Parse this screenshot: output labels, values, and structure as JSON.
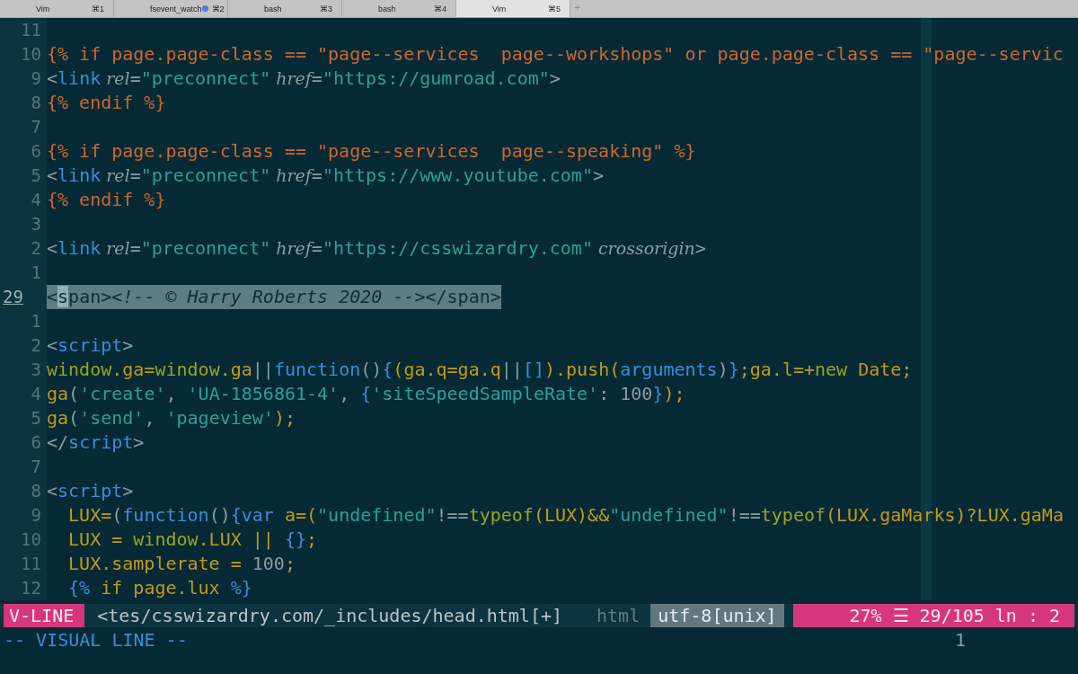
{
  "tabs": [
    {
      "title": "Vim",
      "shortcut": "⌘1",
      "selected": false,
      "activity": false
    },
    {
      "title": "fsevent_watch",
      "shortcut": "⌘2",
      "selected": false,
      "activity": true
    },
    {
      "title": "bash",
      "shortcut": "⌘3",
      "selected": false,
      "activity": false
    },
    {
      "title": "bash",
      "shortcut": "⌘4",
      "selected": false,
      "activity": false
    },
    {
      "title": "Vim",
      "shortcut": "⌘5",
      "selected": true,
      "activity": false
    }
  ],
  "new_tab": "+",
  "editor": {
    "lines": [
      {
        "number": "11",
        "selected": false,
        "current": false
      },
      {
        "number": "10",
        "selected": false,
        "current": false,
        "segments": [
          {
            "text": "{% if page.page-class == \"page--services  page--workshops\" or page.page-class == \"page--servic",
            "kind": "liquid"
          }
        ]
      },
      {
        "number": "9",
        "selected": false,
        "current": false,
        "segments": [
          {
            "text": "<",
            "kind": "punct"
          },
          {
            "text": "link",
            "kind": "tag"
          },
          {
            "text": " rel",
            "kind": "attr"
          },
          {
            "text": "=",
            "kind": "punct"
          },
          {
            "text": "\"preconnect\"",
            "kind": "string"
          },
          {
            "text": " href",
            "kind": "attr"
          },
          {
            "text": "=",
            "kind": "punct"
          },
          {
            "text": "\"https://gumroad.com\"",
            "kind": "string"
          },
          {
            "text": ">",
            "kind": "punct"
          }
        ]
      },
      {
        "number": "8",
        "selected": false,
        "current": false,
        "segments": [
          {
            "text": "{% endif %}",
            "kind": "liquid"
          }
        ]
      },
      {
        "number": "7",
        "selected": false,
        "current": false
      },
      {
        "number": "6",
        "selected": false,
        "current": false,
        "segments": [
          {
            "text": "{% if page.page-class == \"page--services  page--speaking\" %}",
            "kind": "liquid"
          }
        ]
      },
      {
        "number": "5",
        "selected": false,
        "current": false,
        "segments": [
          {
            "text": "<",
            "kind": "punct"
          },
          {
            "text": "link",
            "kind": "tag"
          },
          {
            "text": " rel",
            "kind": "attr"
          },
          {
            "text": "=",
            "kind": "punct"
          },
          {
            "text": "\"preconnect\"",
            "kind": "string"
          },
          {
            "text": " href",
            "kind": "attr"
          },
          {
            "text": "=",
            "kind": "punct"
          },
          {
            "text": "\"https://www.youtube.com\"",
            "kind": "string"
          },
          {
            "text": ">",
            "kind": "punct"
          }
        ]
      },
      {
        "number": "4",
        "selected": false,
        "current": false,
        "segments": [
          {
            "text": "{% endif %}",
            "kind": "liquid"
          }
        ]
      },
      {
        "number": "3",
        "selected": false,
        "current": false
      },
      {
        "number": "2",
        "selected": false,
        "current": false,
        "segments": [
          {
            "text": "<",
            "kind": "punct"
          },
          {
            "text": "link",
            "kind": "tag"
          },
          {
            "text": " rel",
            "kind": "attr"
          },
          {
            "text": "=",
            "kind": "punct"
          },
          {
            "text": "\"preconnect\"",
            "kind": "string"
          },
          {
            "text": " href",
            "kind": "attr"
          },
          {
            "text": "=",
            "kind": "punct"
          },
          {
            "text": "\"https://csswizardry.com\"",
            "kind": "string"
          },
          {
            "text": " crossorigin",
            "kind": "attr"
          },
          {
            "text": ">",
            "kind": "punct"
          }
        ]
      },
      {
        "number": "1",
        "selected": false,
        "current": false
      },
      {
        "number": "29",
        "selected": true,
        "current": true,
        "segments": [
          {
            "text": "<",
            "kind": "plain"
          },
          {
            "text": "s",
            "kind": "cursor"
          },
          {
            "text": "pan>",
            "kind": "plain"
          },
          {
            "text": "<!-- © Harry Roberts 2020 -->",
            "kind": "comment"
          },
          {
            "text": "</span>",
            "kind": "plain"
          }
        ]
      },
      {
        "number": "1",
        "selected": false,
        "current": false
      },
      {
        "number": "2",
        "selected": false,
        "current": false,
        "segments": [
          {
            "text": "<",
            "kind": "punct"
          },
          {
            "text": "script",
            "kind": "tag"
          },
          {
            "text": ">",
            "kind": "punct"
          }
        ]
      },
      {
        "number": "3",
        "selected": false,
        "current": false,
        "segments": [
          {
            "text": "window",
            "kind": "keyword"
          },
          {
            "text": ".ga=",
            "kind": "js"
          },
          {
            "text": "window",
            "kind": "keyword"
          },
          {
            "text": ".ga",
            "kind": "js"
          },
          {
            "text": "||",
            "kind": "punct"
          },
          {
            "text": "function",
            "kind": "tag"
          },
          {
            "text": "()",
            "kind": "punct"
          },
          {
            "text": "{",
            "kind": "tag"
          },
          {
            "text": "(ga.q=ga.q",
            "kind": "js"
          },
          {
            "text": "||",
            "kind": "punct"
          },
          {
            "text": "[]",
            "kind": "tag"
          },
          {
            "text": ").push(",
            "kind": "js"
          },
          {
            "text": "arguments",
            "kind": "tag"
          },
          {
            "text": ")",
            "kind": "punct"
          },
          {
            "text": "}",
            "kind": "tag"
          },
          {
            "text": ";ga.l=+",
            "kind": "js"
          },
          {
            "text": "new",
            "kind": "keyword"
          },
          {
            "text": " Date;",
            "kind": "js"
          }
        ]
      },
      {
        "number": "4",
        "selected": false,
        "current": false,
        "segments": [
          {
            "text": "ga",
            "kind": "js"
          },
          {
            "text": "(",
            "kind": "punct"
          },
          {
            "text": "'create'",
            "kind": "string"
          },
          {
            "text": ", ",
            "kind": "punct"
          },
          {
            "text": "'UA-1856861-4'",
            "kind": "string"
          },
          {
            "text": ", ",
            "kind": "punct"
          },
          {
            "text": "{",
            "kind": "tag"
          },
          {
            "text": "'siteSpeedSampleRate'",
            "kind": "string"
          },
          {
            "text": ": 100",
            "kind": "punct"
          },
          {
            "text": "}",
            "kind": "tag"
          },
          {
            "text": ");",
            "kind": "js"
          }
        ]
      },
      {
        "number": "5",
        "selected": false,
        "current": false,
        "segments": [
          {
            "text": "ga",
            "kind": "js"
          },
          {
            "text": "(",
            "kind": "punct"
          },
          {
            "text": "'send'",
            "kind": "string"
          },
          {
            "text": ", ",
            "kind": "punct"
          },
          {
            "text": "'pageview'",
            "kind": "string"
          },
          {
            "text": ");",
            "kind": "js"
          }
        ]
      },
      {
        "number": "6",
        "selected": false,
        "current": false,
        "segments": [
          {
            "text": "</",
            "kind": "punct"
          },
          {
            "text": "script",
            "kind": "tag"
          },
          {
            "text": ">",
            "kind": "punct"
          }
        ]
      },
      {
        "number": "7",
        "selected": false,
        "current": false
      },
      {
        "number": "8",
        "selected": false,
        "current": false,
        "segments": [
          {
            "text": "<",
            "kind": "punct"
          },
          {
            "text": "script",
            "kind": "tag"
          },
          {
            "text": ">",
            "kind": "punct"
          }
        ]
      },
      {
        "number": "9",
        "selected": false,
        "current": false,
        "segments": [
          {
            "text": "  LUX=",
            "kind": "js"
          },
          {
            "text": "(",
            "kind": "punct"
          },
          {
            "text": "function",
            "kind": "tag"
          },
          {
            "text": "()",
            "kind": "punct"
          },
          {
            "text": "{",
            "kind": "tag"
          },
          {
            "text": "var",
            "kind": "tag"
          },
          {
            "text": " a=(",
            "kind": "js"
          },
          {
            "text": "\"undefined\"",
            "kind": "string"
          },
          {
            "text": "!==",
            "kind": "punct"
          },
          {
            "text": "typeof",
            "kind": "keyword"
          },
          {
            "text": "(LUX)&&",
            "kind": "js"
          },
          {
            "text": "\"undefined\"",
            "kind": "string"
          },
          {
            "text": "!==",
            "kind": "punct"
          },
          {
            "text": "typeof",
            "kind": "keyword"
          },
          {
            "text": "(LUX.gaMarks)?LUX.gaMa",
            "kind": "js"
          }
        ]
      },
      {
        "number": "10",
        "selected": false,
        "current": false,
        "segments": [
          {
            "text": "  LUX = ",
            "kind": "js"
          },
          {
            "text": "window",
            "kind": "keyword"
          },
          {
            "text": ".LUX || ",
            "kind": "js"
          },
          {
            "text": "{}",
            "kind": "tag"
          },
          {
            "text": ";",
            "kind": "js"
          }
        ]
      },
      {
        "number": "11",
        "selected": false,
        "current": false,
        "segments": [
          {
            "text": "  LUX.samplerate = ",
            "kind": "js"
          },
          {
            "text": "100",
            "kind": "punct"
          },
          {
            "text": ";",
            "kind": "js"
          }
        ]
      },
      {
        "number": "12",
        "selected": false,
        "current": false,
        "segments": [
          {
            "text": "  {%",
            "kind": "tag"
          },
          {
            "text": " if page.lux ",
            "kind": "js"
          },
          {
            "text": "%}",
            "kind": "tag"
          }
        ]
      }
    ]
  },
  "status_bar": {
    "segments": [
      {
        "kind": "mode",
        "text": "V-LINE"
      },
      {
        "kind": "file",
        "text": "<tes/csswizardry.com/_includes/head.html[+]"
      },
      {
        "kind": "filetype",
        "text": "html"
      },
      {
        "kind": "encoding",
        "text": "utf-8[unix]"
      },
      {
        "kind": "position",
        "parts": [
          "27%",
          "☰",
          "29/105",
          "ln",
          ":",
          "2"
        ]
      }
    ]
  },
  "command_line": {
    "message": "-- VISUAL LINE --",
    "selection_count": "1"
  }
}
